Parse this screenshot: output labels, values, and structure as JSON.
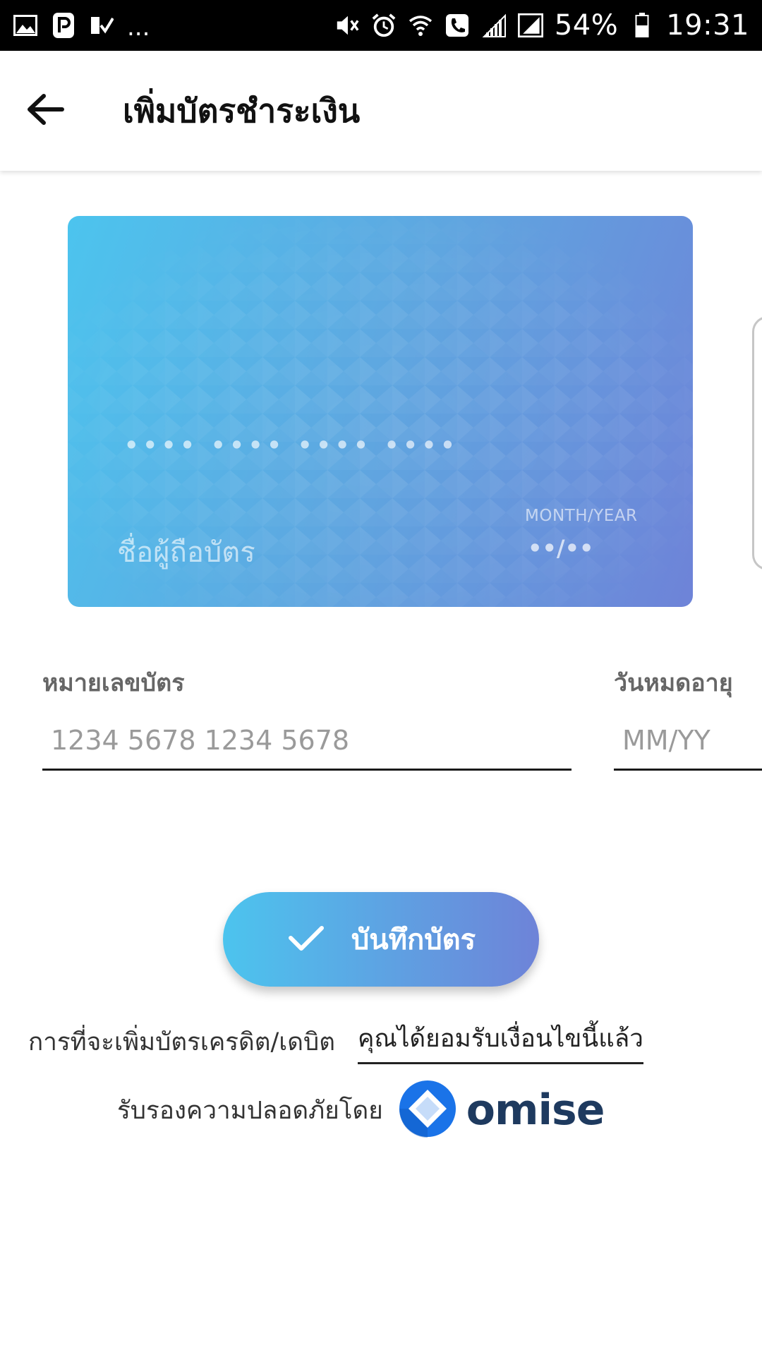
{
  "status_bar": {
    "battery_percent": "54%",
    "time": "19:31",
    "more_indicator": "..."
  },
  "app_bar": {
    "title": "เพิ่มบัตรชำระเงิน"
  },
  "card_preview": {
    "number_mask": "•••• •••• •••• ••••",
    "holder_placeholder": "ชื่อผู้ถือบัตร",
    "expiry_label": "MONTH/YEAR",
    "expiry_mask": "••/••",
    "gradient_start": "#4cc4ee",
    "gradient_end": "#6e83d8"
  },
  "form": {
    "card_number": {
      "label": "หมายเลขบัตร",
      "placeholder": "1234 5678 1234 5678",
      "value": ""
    },
    "expiry": {
      "label": "วันหมดอายุ",
      "placeholder": "MM/YY",
      "value": ""
    }
  },
  "save_button": {
    "label": "บันทึกบัตร",
    "icon": "check-icon"
  },
  "terms": {
    "prefix": "การที่จะเพิ่มบัตรเครดิต/เดบิต",
    "link": "คุณได้ยอมรับเงื่อนไขนี้แล้ว"
  },
  "secured_by": {
    "text": "รับรองความปลอดภัยโดย",
    "brand": "omise",
    "brand_color": "#1e3a5f",
    "logo_color": "#1a73e8"
  }
}
